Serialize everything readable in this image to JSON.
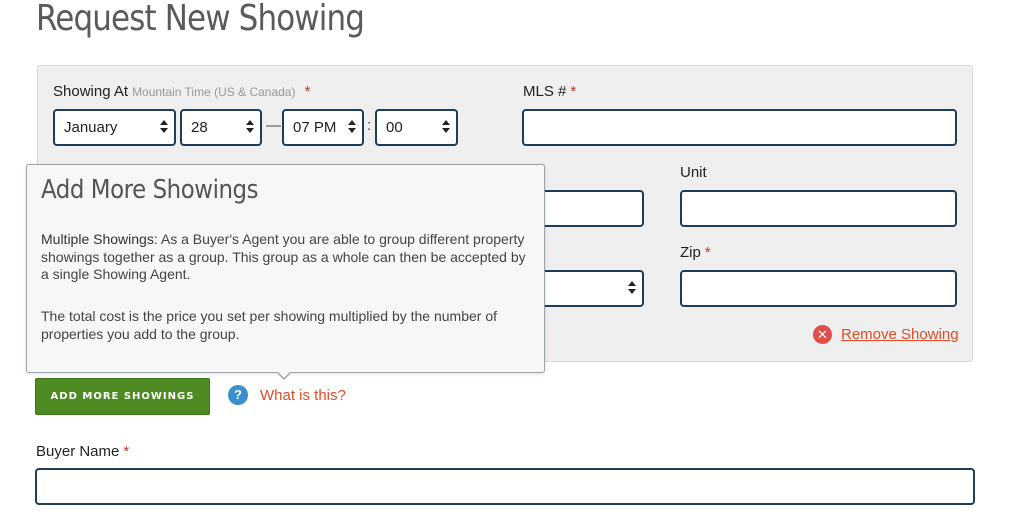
{
  "page": {
    "title": "Request New Showing"
  },
  "form": {
    "showing_at_label": "Showing At",
    "timezone_hint": "Mountain Time (US & Canada)",
    "required_mark": "*",
    "month": "January",
    "day": "28",
    "dash": "—",
    "hour": "07 PM",
    "colon": ":",
    "minute": "00",
    "mls_label": "MLS #",
    "unit_label": "Unit",
    "zip_label": "Zip",
    "remove_label": "Remove Showing",
    "buyer_name_label": "Buyer Name"
  },
  "tooltip": {
    "title": "Add More Showings",
    "lead": "Multiple Showings:",
    "para1": "As a Buyer's Agent you are able to group different property showings together as a group. This group as a whole can then be accepted by a single Showing Agent.",
    "para2": "The total cost is the price you set per showing multiplied by the number of properties you add to the group."
  },
  "actions": {
    "add_more_label": "ADD MORE SHOWINGS",
    "help_label": "What is this?",
    "help_icon": "?",
    "remove_icon": "✕"
  },
  "colors": {
    "accent_green": "#4d8a21",
    "link_orange": "#e24b26",
    "field_border": "#1e3d59",
    "help_blue": "#3a8fd0"
  }
}
